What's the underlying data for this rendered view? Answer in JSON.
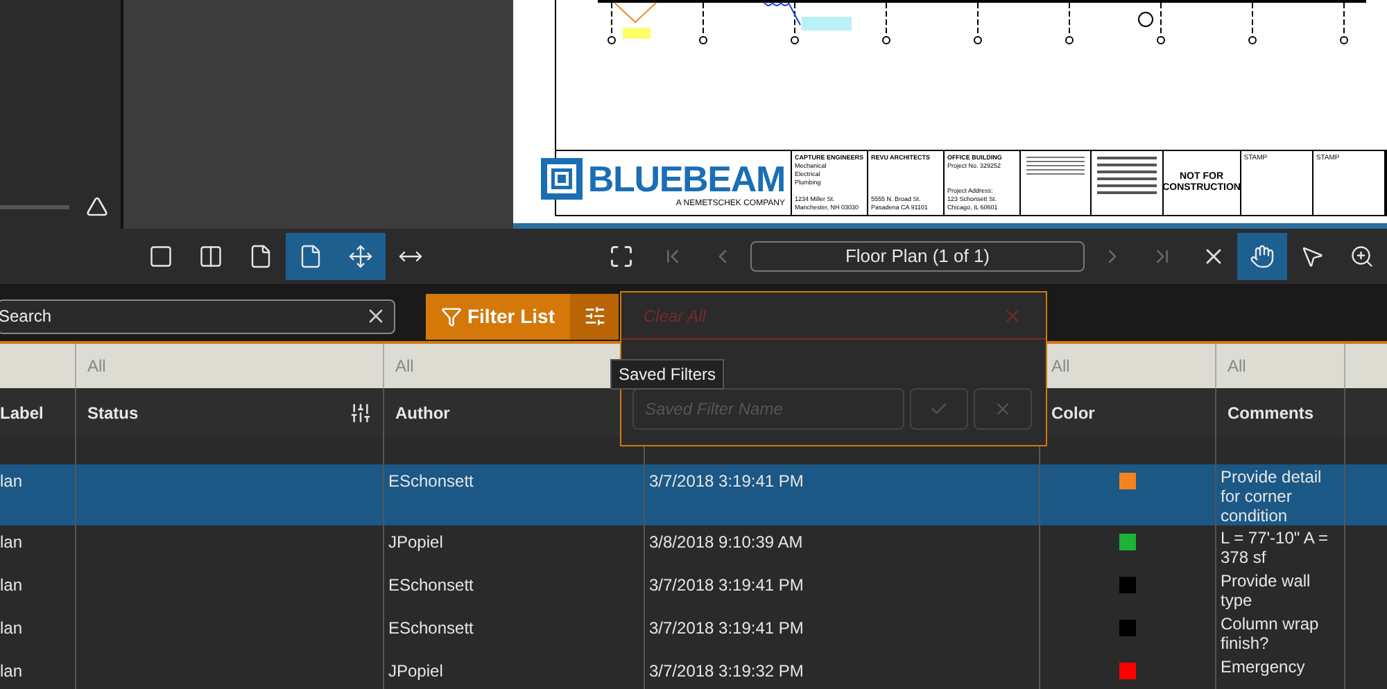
{
  "document": {
    "logo": "BLUEBEAM",
    "logo_sub": "A NEMETSCHEK COMPANY",
    "title_block": [
      {
        "heading": "CAPTURE ENGINEERS",
        "lines": [
          "Mechanical",
          "Electrical",
          "Plumbing"
        ],
        "address": [
          "1234 Miller St.",
          "Manchester, NH 03030"
        ]
      },
      {
        "heading": "REVU ARCHITECTS",
        "address": [
          "5555 N. Broad St.",
          "Pasadena CA 91101"
        ]
      },
      {
        "heading": "OFFICE BUILDING",
        "lines": [
          "Project No. 329252"
        ],
        "address": [
          "Project Address:",
          "123 Schonsett St.",
          "Chicago, IL 60601"
        ]
      }
    ],
    "notice": "NOT FOR CONSTRUCTION",
    "stamps": [
      "STAMP",
      "STAMP"
    ]
  },
  "toolbar": {
    "left": [
      {
        "kind": "panel",
        "selected": false
      },
      {
        "kind": "split",
        "selected": false
      },
      {
        "kind": "actual",
        "selected": false
      },
      {
        "kind": "page",
        "selected": true
      },
      {
        "kind": "move",
        "selected": true
      },
      {
        "kind": "width",
        "selected": false
      }
    ],
    "page_field": "Floor Plan (1 of 1)",
    "right": [
      {
        "kind": "hand",
        "selected": true
      },
      {
        "kind": "pointer",
        "selected": false
      },
      {
        "kind": "zoom",
        "selected": false
      }
    ]
  },
  "search": {
    "placeholder": "Search"
  },
  "filter_button": "Filter List",
  "popup": {
    "clear_all": "Clear All",
    "placeholder": "Saved Filter Name"
  },
  "tooltip": "Saved Filters",
  "table": {
    "columns": [
      {
        "name": "Label"
      },
      {
        "name": "Status",
        "filter": "All"
      },
      {
        "name": "Author",
        "filter": "All"
      },
      {},
      {
        "name": "Color",
        "filter": "All"
      },
      {
        "name": "Comments",
        "filter": "All"
      }
    ],
    "rows": [
      {
        "selected": true,
        "label": "lan",
        "author": "ESchonsett",
        "date": "3/7/2018 3:19:41 PM",
        "color": "#f5821f",
        "comments": "Provide detail for corner condition"
      },
      {
        "selected": false,
        "label": "lan",
        "author": "JPopiel",
        "date": "3/8/2018 9:10:39 AM",
        "color": "#1db337",
        "comments": "L = 77'-10\" A = 378 sf"
      },
      {
        "selected": false,
        "label": "lan",
        "author": "ESchonsett",
        "date": "3/7/2018 3:19:41 PM",
        "color": "#000000",
        "comments": "Provide wall type"
      },
      {
        "selected": false,
        "label": "lan",
        "author": "ESchonsett",
        "date": "3/7/2018 3:19:41 PM",
        "color": "#000000",
        "comments": "Column wrap finish?"
      },
      {
        "selected": false,
        "label": "lan",
        "author": "JPopiel",
        "date": "3/7/2018 3:19:32 PM",
        "color": "#ff0000",
        "comments": "Emergency"
      }
    ]
  }
}
